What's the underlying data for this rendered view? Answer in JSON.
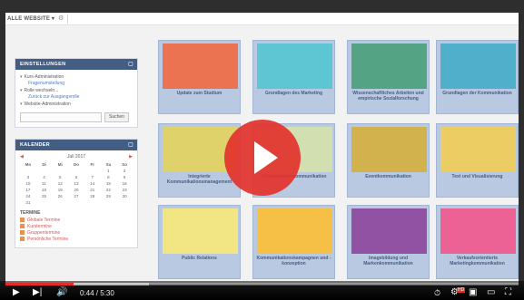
{
  "topbar": {
    "menu_label": "ALLE WEBSITE ▾",
    "gear_icon": "gear-icon"
  },
  "settings": {
    "title": "EINSTELLUNGEN",
    "items": [
      {
        "label": "Kurs-Administration",
        "sub": "Fragenumstellung"
      },
      {
        "label": "Rolle wechseln...",
        "sub": "Zurück zur Ausgangsrolle"
      },
      {
        "label": "Website-Administration",
        "sub": ""
      }
    ],
    "search_button": "Suchen"
  },
  "calendar": {
    "title": "KALENDER",
    "month": "Juli 2017",
    "weekdays": [
      "Mo",
      "Di",
      "Mi",
      "Do",
      "Fr",
      "Sa",
      "So"
    ],
    "days": [
      "",
      "",
      "",
      "",
      "",
      "1",
      "2",
      "3",
      "4",
      "5",
      "6",
      "7",
      "8",
      "9",
      "10",
      "11",
      "12",
      "13",
      "14",
      "15",
      "16",
      "17",
      "18",
      "19",
      "20",
      "21",
      "22",
      "23",
      "24",
      "25",
      "26",
      "27",
      "28",
      "29",
      "30",
      "31"
    ],
    "termine_title": "TERMINE",
    "events": [
      "Globale Termine",
      "Kurstermine",
      "Gruppentermine",
      "Persönliche Termine"
    ]
  },
  "tiles": [
    {
      "caption": "Update zum Studium",
      "color": "#e8552b"
    },
    {
      "caption": "Grundlagen des Marketing",
      "color": "#3bb9c9"
    },
    {
      "caption": "Wissenschaftliches Arbeiten und empirische Sozialforschung",
      "color": "#2e8f6a"
    },
    {
      "caption": "Grundlagen der Kommunikation",
      "color": "#2a9ec0"
    },
    {
      "caption": "Integrierte Kommunikationsmanagement",
      "color": "#d9c84a"
    },
    {
      "caption": "Unternehmenskommunikation",
      "color": "#c9d9a0"
    },
    {
      "caption": "Eventkommunikation",
      "color": "#c9a227"
    },
    {
      "caption": "Text und Visualisierung",
      "color": "#e8c342"
    },
    {
      "caption": "Public Relations",
      "color": "#f0e06a"
    },
    {
      "caption": "Kommunikationskampagnen und -konzeption",
      "color": "#f4b31f"
    },
    {
      "caption": "Imagebildung und Markenkommunikation",
      "color": "#7b2c90"
    },
    {
      "caption": "Verkaufsorientierte Marketingkommunikation",
      "color": "#e8407e"
    }
  ],
  "player": {
    "time": "0:44 / 5:30",
    "progress_played": 0.133,
    "progress_loaded": 0.28,
    "accent": "#e52d27",
    "hd_label": "HD"
  }
}
